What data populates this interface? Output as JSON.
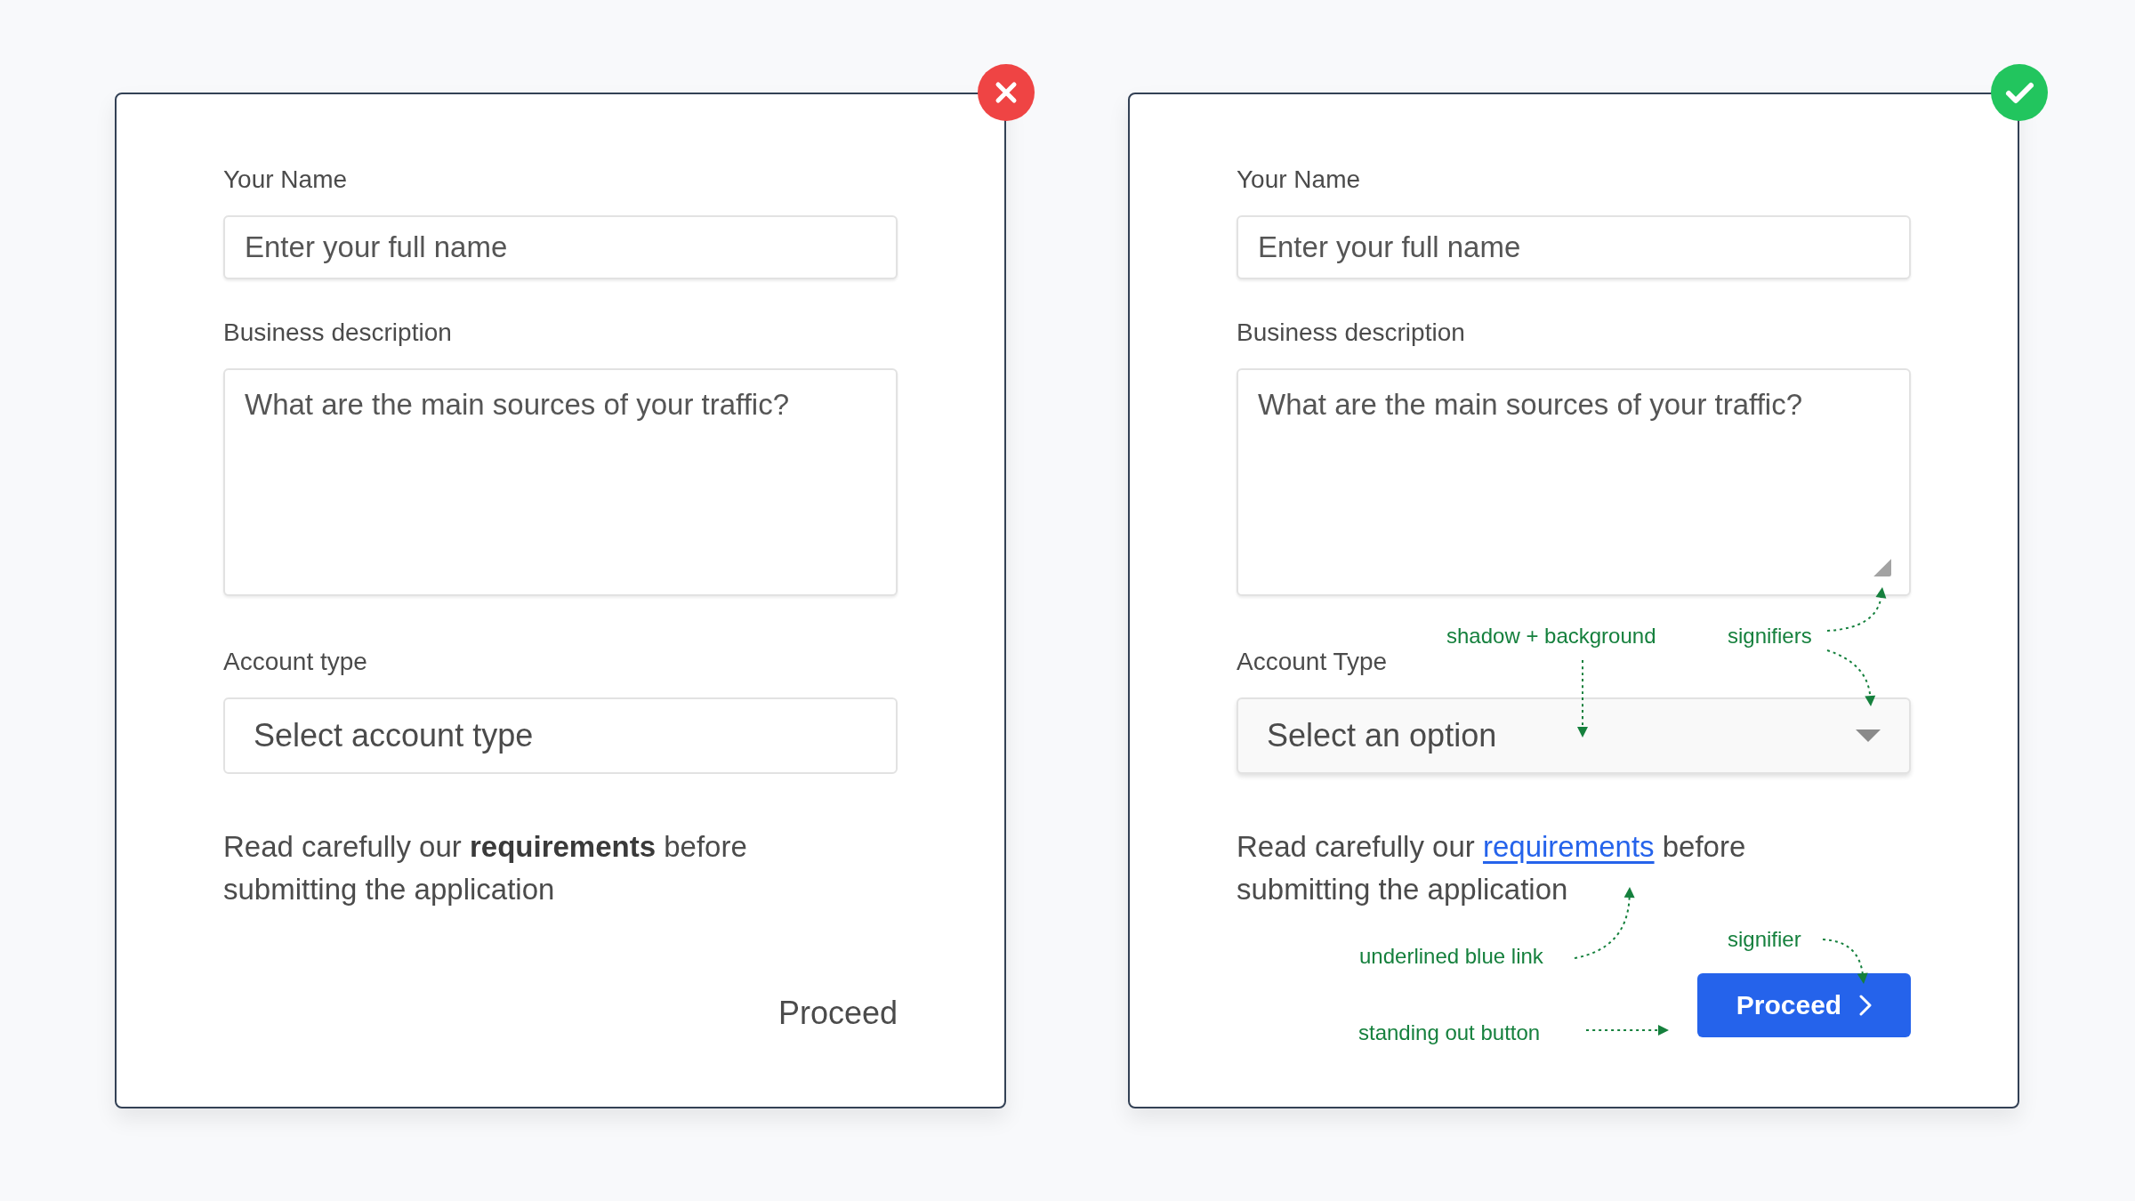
{
  "panels": [
    {
      "kind": "wrong",
      "fields": [
        {
          "kind": "text",
          "label": "Your Name",
          "placeholder": "Enter your full name"
        },
        {
          "kind": "textarea",
          "label": "Business description",
          "placeholder": "What are the main sources of your traffic?",
          "resize_handle": false
        },
        {
          "kind": "select",
          "label": "Account type",
          "value": "Select account type",
          "caret": false,
          "shaded": false
        }
      ],
      "note": {
        "before": "Read carefully our",
        "emphasis": "requirements",
        "after": "before submitting the application",
        "kind": "bold"
      },
      "action": {
        "label": "Proceed",
        "kind": "text"
      }
    },
    {
      "kind": "right",
      "fields": [
        {
          "kind": "text",
          "label": "Your Name",
          "placeholder": "Enter your full name"
        },
        {
          "kind": "textarea",
          "label": "Business description",
          "placeholder": "What are the main sources of your traffic?",
          "resize_handle": true
        },
        {
          "kind": "select",
          "label": "Account Type",
          "value": "Select an option",
          "caret": true,
          "shaded": true
        }
      ],
      "note": {
        "before": "Read carefully our",
        "emphasis": "requirements",
        "after": "before submitting the application",
        "kind": "link"
      },
      "action": {
        "label": "Proceed",
        "kind": "primary"
      },
      "annotations": [
        {
          "text": "shadow + background"
        },
        {
          "text": "signifiers"
        },
        {
          "text": "underlined blue link"
        },
        {
          "text": "signifier"
        },
        {
          "text": "standing out button"
        }
      ]
    }
  ]
}
